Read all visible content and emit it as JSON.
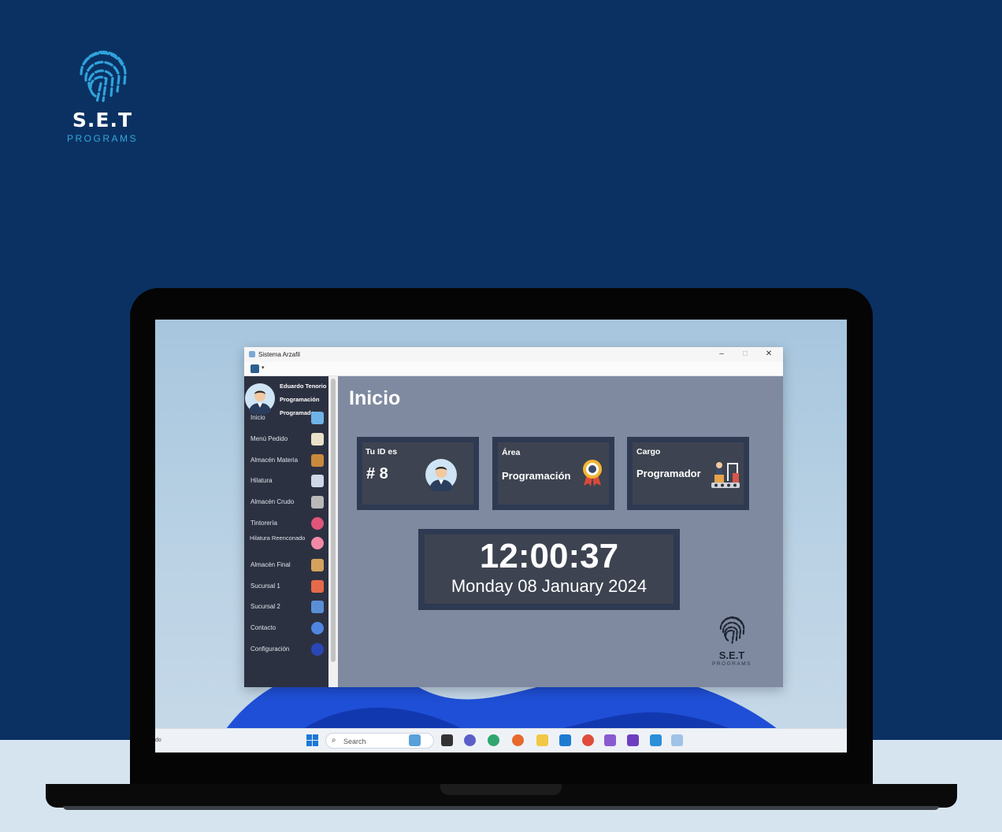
{
  "brand": {
    "name": "S.E.T",
    "tagline": "PROGRAMS"
  },
  "window": {
    "title": "Sistema Arzafil",
    "controls": [
      "–",
      "□",
      "✕"
    ]
  },
  "user": {
    "name": "Eduardo Tenorio",
    "area": "Programación",
    "role": "Programador"
  },
  "sidebar": {
    "items": [
      {
        "label": "Inicio",
        "icon": "home-icon",
        "color": "#6fb3e8"
      },
      {
        "label": "Menú Pedido",
        "icon": "order-menu-icon",
        "color": "#e9e2c8"
      },
      {
        "label": "Almacén Materia",
        "icon": "raw-material-box-icon",
        "color": "#c88a3c"
      },
      {
        "label": "Hilatura",
        "icon": "thread-spool-icon",
        "color": "#cfd8e6"
      },
      {
        "label": "Almacén Crudo",
        "icon": "warehouse-icon",
        "color": "#b9b9b9"
      },
      {
        "label": "Tintorería",
        "icon": "color-wheel-icon",
        "color": "#e0557a"
      },
      {
        "label": "Hilatura Reenconado",
        "icon": "yarn-rewind-icon",
        "color": "#f28aa6"
      },
      {
        "label": "Almacén Final",
        "icon": "final-warehouse-icon",
        "color": "#d4a25c"
      },
      {
        "label": "Sucursal 1",
        "icon": "store-icon",
        "color": "#e56a4a"
      },
      {
        "label": "Sucursal 2",
        "icon": "store-icon",
        "color": "#5a8fd6"
      },
      {
        "label": "Contacto",
        "icon": "contact-icon",
        "color": "#4f86e0"
      },
      {
        "label": "Configuración",
        "icon": "settings-icon",
        "color": "#2a47b8"
      }
    ]
  },
  "main": {
    "title": "Inicio",
    "cards": {
      "id": {
        "label": "Tu ID es",
        "value": "# 8"
      },
      "area": {
        "label": "Área",
        "value": "Programación"
      },
      "cargo": {
        "label": "Cargo",
        "value": "Programador"
      }
    },
    "clock": {
      "time": "12:00:37",
      "date": "Monday 08 January 2024"
    }
  },
  "taskbar": {
    "left_text": "do",
    "search_placeholder": "Search",
    "apps": [
      {
        "icon": "widgets-icon",
        "color": "#5aa0d8"
      },
      {
        "icon": "task-view-icon",
        "color": "#333333"
      },
      {
        "icon": "teams-chat-icon",
        "color": "#5b5fc7"
      },
      {
        "icon": "edge-browser-icon",
        "color": "#2fa66e"
      },
      {
        "icon": "firefox-icon",
        "color": "#e8692c"
      },
      {
        "icon": "file-explorer-icon",
        "color": "#f2c744"
      },
      {
        "icon": "vscode-icon",
        "color": "#1f7bd1"
      },
      {
        "icon": "chrome-icon",
        "color": "#e04b3b"
      },
      {
        "icon": "visual-studio-icon",
        "color": "#8a5ad1"
      },
      {
        "icon": "visual-studio-preview-icon",
        "color": "#6d3fc0"
      },
      {
        "icon": "photos-icon",
        "color": "#2b8fd8"
      },
      {
        "icon": "sistema-arzafil-icon",
        "color": "#9fc3e6"
      }
    ]
  }
}
